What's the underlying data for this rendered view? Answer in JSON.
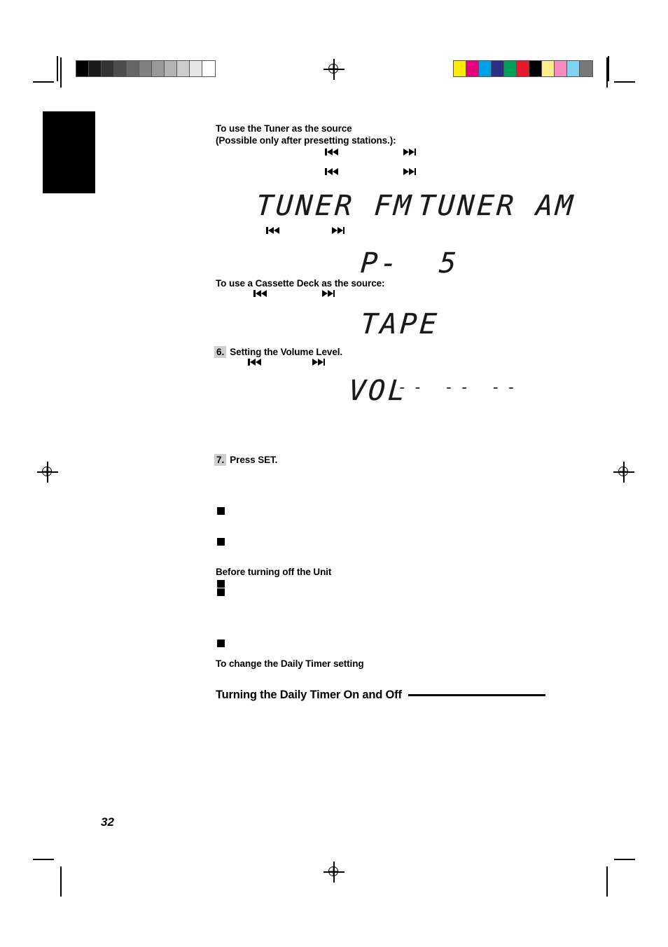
{
  "document": {
    "page_number": "32"
  },
  "printer_marks": {
    "grayscale_bar": {
      "name": "grayscale-calibration-bar",
      "swatches": [
        "#000000",
        "#1a1a1a",
        "#333333",
        "#4d4d4d",
        "#666666",
        "#808080",
        "#999999",
        "#b3b3b3",
        "#cccccc",
        "#e6e6e6",
        "#ffffff"
      ]
    },
    "color_bar": {
      "name": "color-calibration-bar",
      "swatches": [
        "#fced00",
        "#e6007e",
        "#00a0e9",
        "#2b2f86",
        "#00a05a",
        "#e8192c",
        "#000000",
        "#fcee8c",
        "#f68bbd",
        "#7fd4f4",
        "#787878"
      ]
    }
  },
  "content": {
    "tuner_section": {
      "heading": "To use the Tuner as the source\n(Possible only after presetting stations.):",
      "display_fm": "TUNER FM",
      "display_am": "TUNER AM",
      "display_preset": "P-  5"
    },
    "tape_section": {
      "heading": "To use a Cassette Deck as the source:",
      "display_tape": "TAPE"
    },
    "volume_step": {
      "number": "6.",
      "label": "Setting the Volume Level.",
      "display_vol": "VOL",
      "display_vol_digits": "-- -- --"
    },
    "set_step": {
      "number": "7.",
      "label": "Press SET."
    },
    "before_off_heading": "Before turning off the Unit",
    "change_timer_heading": "To change the Daily Timer setting",
    "section_heading": "Turning the Daily Timer On and Off"
  },
  "icons": {
    "prev_track": "prev-track-icon",
    "next_track": "next-track-icon",
    "registration": "registration-mark-icon",
    "bullet": "square-bullet-icon"
  }
}
